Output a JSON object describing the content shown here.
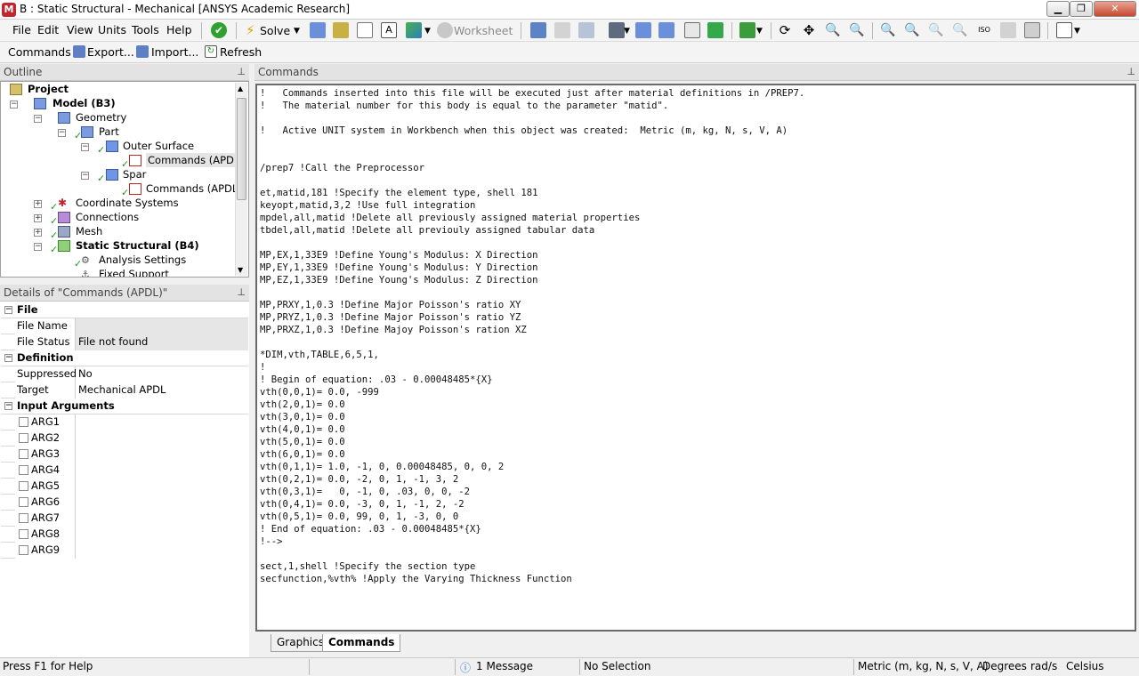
{
  "window": {
    "title": "B : Static Structural - Mechanical [ANSYS Academic Research]",
    "app_icon": "M"
  },
  "menu": [
    "File",
    "Edit",
    "View",
    "Units",
    "Tools",
    "Help"
  ],
  "toolbar1": {
    "solve_label": "Solve",
    "worksheet_label": "Worksheet"
  },
  "toolbar2": {
    "commands_label": "Commands",
    "export_label": "Export...",
    "import_label": "Import...",
    "refresh_label": "Refresh"
  },
  "outline": {
    "header": "Outline",
    "items": [
      {
        "label": "Project",
        "bold": true
      },
      {
        "label": "Model (B3)",
        "bold": true
      },
      {
        "label": "Geometry"
      },
      {
        "label": "Part"
      },
      {
        "label": "Outer Surface"
      },
      {
        "label": "Commands (APDL)"
      },
      {
        "label": "Spar"
      },
      {
        "label": "Commands (APDL)"
      },
      {
        "label": "Coordinate Systems"
      },
      {
        "label": "Connections"
      },
      {
        "label": "Mesh"
      },
      {
        "label": "Static Structural (B4)",
        "bold": true
      },
      {
        "label": "Analysis Settings"
      },
      {
        "label": "Fixed Support"
      }
    ]
  },
  "details": {
    "header": "Details of \"Commands (APDL)\"",
    "groups": {
      "file": "File",
      "definition": "Definition",
      "input_args": "Input Arguments"
    },
    "rows": {
      "file_name_label": "File Name",
      "file_name_value": "",
      "file_status_label": "File Status",
      "file_status_value": "File not found",
      "suppressed_label": "Suppressed",
      "suppressed_value": "No",
      "target_label": "Target",
      "target_value": "Mechanical APDL"
    },
    "args": [
      "ARG1",
      "ARG2",
      "ARG3",
      "ARG4",
      "ARG5",
      "ARG6",
      "ARG7",
      "ARG8",
      "ARG9"
    ]
  },
  "commands": {
    "header": "Commands",
    "lines": [
      "!   Commands inserted into this file will be executed just after material definitions in /PREP7.",
      "!   The material number for this body is equal to the parameter \"matid\".",
      "",
      "!   Active UNIT system in Workbench when this object was created:  Metric (m, kg, N, s, V, A)",
      "",
      "",
      "/prep7 !Call the Preprocessor",
      "",
      "et,matid,181 !Specify the element type, shell 181",
      "keyopt,matid,3,2 !Use full integration",
      "mpdel,all,matid !Delete all previously assigned material properties",
      "tbdel,all,matid !Delete all previouly assigned tabular data",
      "",
      "MP,EX,1,33E9 !Define Young's Modulus: X Direction",
      "MP,EY,1,33E9 !Define Young's Modulus: Y Direction",
      "MP,EZ,1,33E9 !Define Young's Modulus: Z Direction",
      "",
      "MP,PRXY,1,0.3 !Define Major Poisson's ratio XY",
      "MP,PRYZ,1,0.3 !Define Major Poisson's ratio YZ",
      "MP,PRXZ,1,0.3 !Define Majoy Poisson's ration XZ",
      "",
      "*DIM,vth,TABLE,6,5,1,",
      "!",
      "! Begin of equation: .03 - 0.00048485*{X}",
      "vth(0,0,1)= 0.0, -999",
      "vth(2,0,1)= 0.0",
      "vth(3,0,1)= 0.0",
      "vth(4,0,1)= 0.0",
      "vth(5,0,1)= 0.0",
      "vth(6,0,1)= 0.0",
      "vth(0,1,1)= 1.0, -1, 0, 0.00048485, 0, 0, 2",
      "vth(0,2,1)= 0.0, -2, 0, 1, -1, 3, 2",
      "vth(0,3,1)=   0, -1, 0, .03, 0, 0, -2",
      "vth(0,4,1)= 0.0, -3, 0, 1, -1, 2, -2",
      "vth(0,5,1)= 0.0, 99, 0, 1, -3, 0, 0",
      "! End of equation: .03 - 0.00048485*{X}",
      "!-->",
      "",
      "sect,1,shell !Specify the section type",
      "secfunction,%vth% !Apply the Varying Thickness Function"
    ]
  },
  "tabs": [
    "Graphics",
    "Commands"
  ],
  "status": {
    "help": "Press F1 for Help",
    "messages": "1 Message",
    "selection": "No Selection",
    "units": "Metric (m, kg, N, s, V, A)",
    "angle": "Degrees",
    "rot": "rad/s",
    "temp": "Celsius"
  }
}
